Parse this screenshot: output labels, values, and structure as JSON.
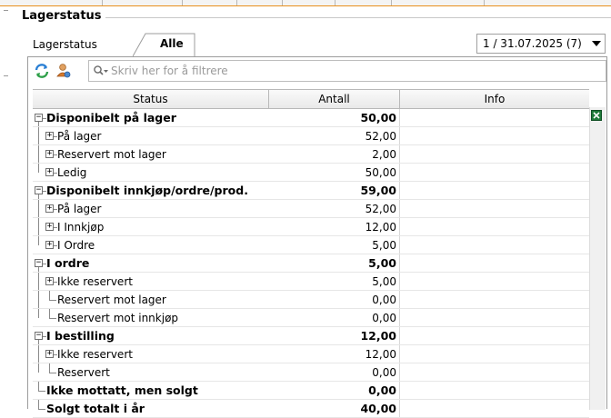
{
  "section": {
    "title": "Lagerstatus"
  },
  "tabs": [
    {
      "label": "Lagerstatus",
      "active": false
    },
    {
      "label": "Alle",
      "active": true
    }
  ],
  "period": {
    "selected": "1 / 31.07.2025 (7)"
  },
  "toolbar": {
    "refresh_icon": "refresh-icon",
    "user_icon": "user-settings-icon",
    "filter_placeholder": "Skriv her for å filtrere"
  },
  "grid": {
    "columns": [
      "Status",
      "Antall",
      "Info"
    ],
    "rows": [
      {
        "label": "Disponibelt på lager",
        "value": "50,00",
        "level": 0,
        "bold": true,
        "expander": "minus"
      },
      {
        "label": "På lager",
        "value": "52,00",
        "level": 1,
        "bold": false,
        "expander": "plus"
      },
      {
        "label": "Reservert mot lager",
        "value": "2,00",
        "level": 1,
        "bold": false,
        "expander": "plus"
      },
      {
        "label": "Ledig",
        "value": "50,00",
        "level": 1,
        "bold": false,
        "expander": "plus"
      },
      {
        "label": "Disponibelt innkjøp/ordre/prod.",
        "value": "59,00",
        "level": 0,
        "bold": true,
        "expander": "minus"
      },
      {
        "label": "På lager",
        "value": "52,00",
        "level": 1,
        "bold": false,
        "expander": "plus"
      },
      {
        "label": "I Innkjøp",
        "value": "12,00",
        "level": 1,
        "bold": false,
        "expander": "plus"
      },
      {
        "label": "I Ordre",
        "value": "5,00",
        "level": 1,
        "bold": false,
        "expander": "plus"
      },
      {
        "label": "I ordre",
        "value": "5,00",
        "level": 0,
        "bold": true,
        "expander": "minus"
      },
      {
        "label": "Ikke reservert",
        "value": "5,00",
        "level": 1,
        "bold": false,
        "expander": "plus"
      },
      {
        "label": "Reservert mot lager",
        "value": "0,00",
        "level": 1,
        "bold": false,
        "expander": "none"
      },
      {
        "label": "Reservert mot innkjøp",
        "value": "0,00",
        "level": 1,
        "bold": false,
        "expander": "none"
      },
      {
        "label": "I bestilling",
        "value": "12,00",
        "level": 0,
        "bold": true,
        "expander": "minus"
      },
      {
        "label": "Ikke reservert",
        "value": "12,00",
        "level": 1,
        "bold": false,
        "expander": "plus"
      },
      {
        "label": "Reservert",
        "value": "0,00",
        "level": 1,
        "bold": false,
        "expander": "none"
      },
      {
        "label": "Ikke mottatt, men solgt",
        "value": "0,00",
        "level": 0,
        "bold": true,
        "expander": "none"
      },
      {
        "label": "Solgt totalt i år",
        "value": "40,00",
        "level": 0,
        "bold": true,
        "expander": "none"
      }
    ]
  },
  "colors": {
    "accent": "#e8901e",
    "excel": "#1f7a3a"
  }
}
